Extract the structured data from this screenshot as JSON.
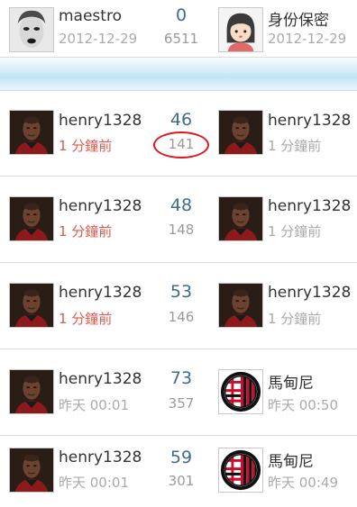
{
  "rows": [
    {
      "author": "maestro",
      "author_time": "2012-12-29",
      "author_avatar": "woman-face-icon",
      "replies": "0",
      "views": "6511",
      "last": "身份保密",
      "last_time": "2012-12-29",
      "last_avatar": "default-girl-icon"
    },
    {
      "author": "henry1328",
      "author_time": "1 分鐘前",
      "author_avatar": "man-photo-icon",
      "replies": "46",
      "views": "141",
      "last": "henry1328",
      "last_time": "1 分鐘前",
      "last_avatar": "man-photo-icon"
    },
    {
      "author": "henry1328",
      "author_time": "1 分鐘前",
      "author_avatar": "man-photo-icon",
      "replies": "48",
      "views": "148",
      "last": "henry1328",
      "last_time": "1 分鐘前",
      "last_avatar": "man-photo-icon"
    },
    {
      "author": "henry1328",
      "author_time": "1 分鐘前",
      "author_avatar": "man-photo-icon",
      "replies": "53",
      "views": "146",
      "last": "henry1328",
      "last_time": "1 分鐘前",
      "last_avatar": "man-photo-icon"
    },
    {
      "author": "henry1328",
      "author_time": "昨天 00:01",
      "author_avatar": "man-photo-icon",
      "replies": "73",
      "views": "357",
      "last": "馬甸尼",
      "last_time": "昨天 00:50",
      "last_avatar": "ac-milan-crest-icon"
    },
    {
      "author": "henry1328",
      "author_time": "昨天 00:01",
      "author_avatar": "man-photo-icon",
      "replies": "59",
      "views": "301",
      "last": "馬甸尼",
      "last_time": "昨天 00:49",
      "last_avatar": "ac-milan-crest-icon"
    }
  ],
  "colors": {
    "recent_time": "#e05a4f",
    "reply_count": "#3e6c90",
    "annotation_circle": "#e0171f"
  }
}
